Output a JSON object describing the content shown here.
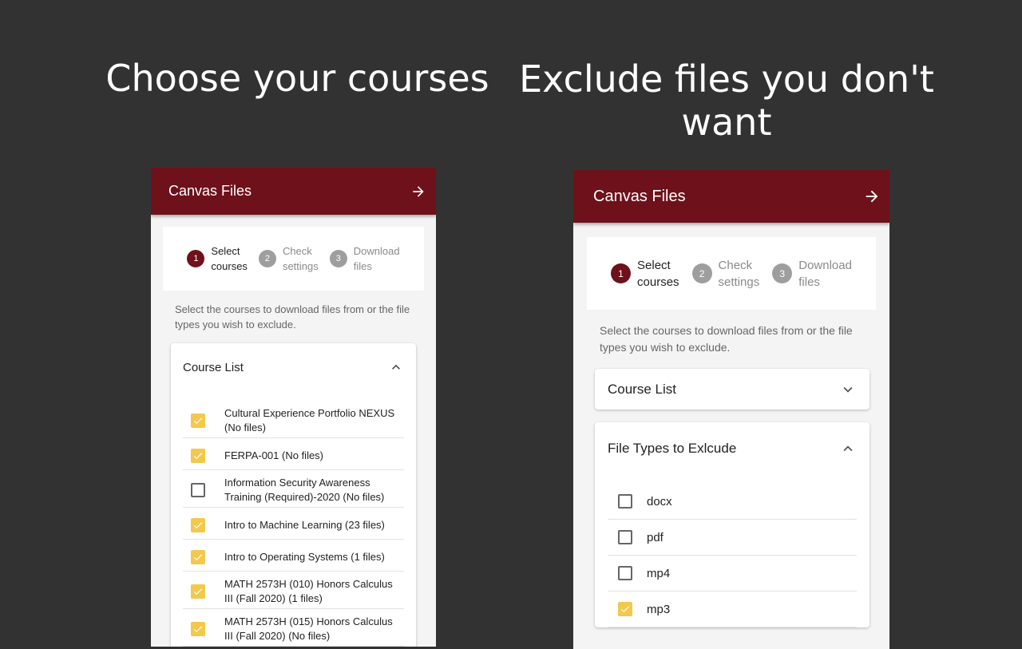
{
  "headlines": {
    "left": "Choose your courses",
    "right": "Exclude files you don't want"
  },
  "colors": {
    "background": "#333232",
    "appbar": "#6e111a",
    "checkbox_checked": "#f2c94c",
    "step_inactive": "#9e9e9e"
  },
  "left_panel": {
    "app_title": "Canvas Files",
    "next_icon": "arrow-right-icon",
    "steps": [
      {
        "num": "1",
        "label": "Select courses",
        "active": true
      },
      {
        "num": "2",
        "label": "Check settings",
        "active": false
      },
      {
        "num": "3",
        "label": "Download files",
        "active": false
      }
    ],
    "description": "Select the courses to download files from or the file types you wish to exclude.",
    "course_list": {
      "title": "Course List",
      "expanded": true,
      "items": [
        {
          "label": "Cultural Experience Portfolio NEXUS (No files)",
          "checked": true
        },
        {
          "label": "FERPA-001 (No files)",
          "checked": true
        },
        {
          "label": "Information Security Awareness Training (Required)-2020 (No files)",
          "checked": false
        },
        {
          "label": "Intro to Machine Learning (23 files)",
          "checked": true
        },
        {
          "label": "Intro to Operating Systems (1 files)",
          "checked": true
        },
        {
          "label": "MATH 2573H (010) Honors Calculus III (Fall 2020) (1 files)",
          "checked": true
        },
        {
          "label": "MATH 2573H (015) Honors Calculus III (Fall 2020) (No files)",
          "checked": true
        }
      ]
    }
  },
  "right_panel": {
    "app_title": "Canvas Files",
    "next_icon": "arrow-right-icon",
    "steps": [
      {
        "num": "1",
        "label": "Select courses",
        "active": true
      },
      {
        "num": "2",
        "label": "Check settings",
        "active": false
      },
      {
        "num": "3",
        "label": "Download files",
        "active": false
      }
    ],
    "description": "Select the courses to download files from or the file types you wish to exclude.",
    "course_list": {
      "title": "Course List",
      "expanded": false
    },
    "file_types": {
      "title": "File Types to Exlcude",
      "expanded": true,
      "items": [
        {
          "label": "docx",
          "checked": false
        },
        {
          "label": "pdf",
          "checked": false
        },
        {
          "label": "mp4",
          "checked": false
        },
        {
          "label": "mp3",
          "checked": true
        }
      ]
    }
  }
}
